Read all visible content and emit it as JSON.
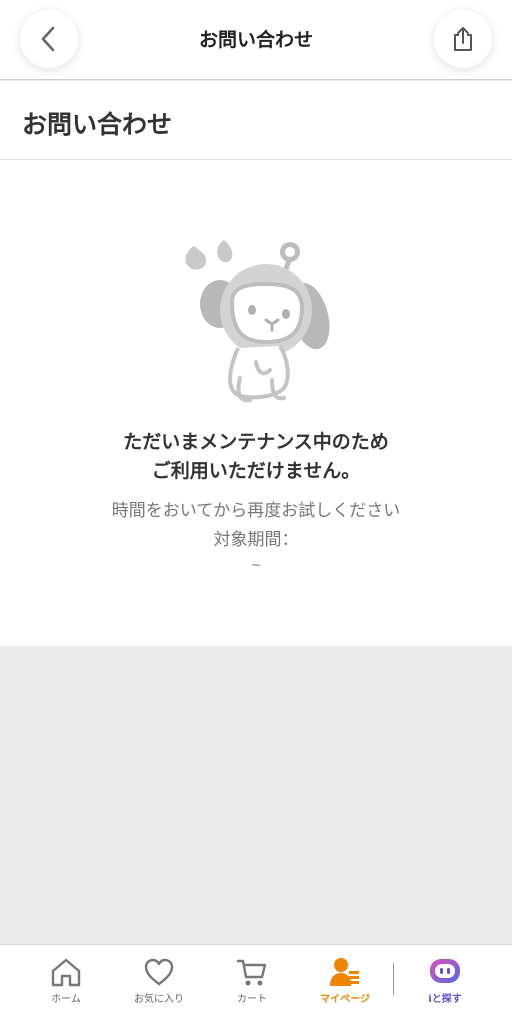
{
  "header": {
    "title": "お問い合わせ",
    "back_icon": "chevron-left-icon",
    "share_icon": "share-icon"
  },
  "section": {
    "title": "お問い合わせ"
  },
  "maintenance": {
    "illustration": "mascot-dog-apologizing-illustration",
    "line1": "ただいまメンテナンス中のため",
    "line2": "ご利用いただけません。",
    "retry_line": "時間をおいてから再度お試しください",
    "period_label": "対象期間：",
    "period_value": "~"
  },
  "bottom_nav": {
    "items": [
      {
        "label": "ホーム",
        "icon": "home-icon",
        "active": false
      },
      {
        "label": "お気に入り",
        "icon": "heart-icon",
        "active": false
      },
      {
        "label": "カート",
        "icon": "cart-icon",
        "active": false
      },
      {
        "label": "マイページ",
        "icon": "mypage-icon",
        "active": true
      },
      {
        "label": "iと探す",
        "icon": "ai-search-icon",
        "active": false
      }
    ]
  },
  "colors": {
    "accent": "#f08300",
    "ai_purple": "#5a55d9",
    "background": "#ebebeb"
  }
}
